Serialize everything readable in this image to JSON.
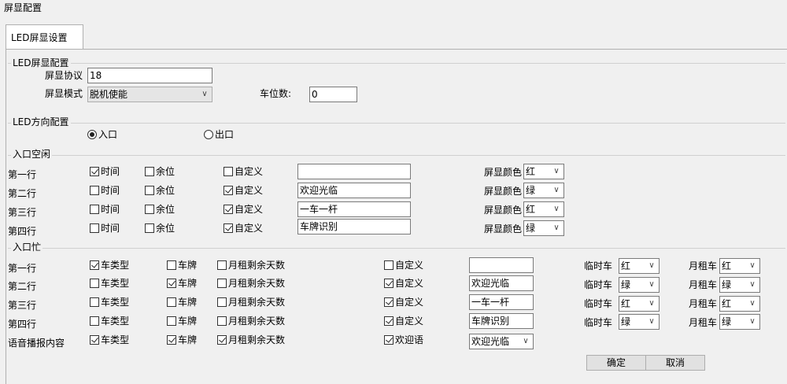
{
  "window": {
    "title": "屏显配置"
  },
  "tab": {
    "label": "LED屏显设置"
  },
  "led_config": {
    "legend": "LED屏显配置",
    "protocol_label": "屏显协议",
    "protocol_value": "18",
    "mode_label": "屏显模式",
    "mode_value": "脱机使能",
    "spaces_label": "车位数:",
    "spaces_value": "0"
  },
  "direction": {
    "legend": "LED方向配置",
    "entry": "入口",
    "exit": "出口"
  },
  "idle": {
    "legend": "入口空闲",
    "color_label": "屏显颜色",
    "rows": [
      {
        "label": "第一行",
        "time": "时间",
        "time_checked": true,
        "remain": "余位",
        "remain_checked": false,
        "custom": "自定义",
        "custom_checked": false,
        "text": "",
        "color": "红"
      },
      {
        "label": "第二行",
        "time": "时间",
        "time_checked": false,
        "remain": "余位",
        "remain_checked": false,
        "custom": "自定义",
        "custom_checked": true,
        "text": "欢迎光临",
        "color": "绿"
      },
      {
        "label": "第三行",
        "time": "时间",
        "time_checked": false,
        "remain": "余位",
        "remain_checked": false,
        "custom": "自定义",
        "custom_checked": true,
        "text": "一车一杆",
        "color": "红"
      },
      {
        "label": "第四行",
        "time": "时间",
        "time_checked": false,
        "remain": "余位",
        "remain_checked": false,
        "custom": "自定义",
        "custom_checked": true,
        "text": "车牌识别",
        "color": "绿"
      }
    ]
  },
  "busy": {
    "legend": "入口忙",
    "temp_label": "临时车",
    "monthly_label": "月租车",
    "rows": [
      {
        "label": "第一行",
        "cartype": "车类型",
        "cartype_checked": true,
        "plate": "车牌",
        "plate_checked": false,
        "days": "月租剩余天数",
        "days_checked": false,
        "custom": "自定义",
        "custom_checked": false,
        "text": "",
        "temp_color": "红",
        "monthly_color": "红"
      },
      {
        "label": "第二行",
        "cartype": "车类型",
        "cartype_checked": false,
        "plate": "车牌",
        "plate_checked": true,
        "days": "月租剩余天数",
        "days_checked": false,
        "custom": "自定义",
        "custom_checked": true,
        "text": "欢迎光临",
        "temp_color": "绿",
        "monthly_color": "绿"
      },
      {
        "label": "第三行",
        "cartype": "车类型",
        "cartype_checked": false,
        "plate": "车牌",
        "plate_checked": false,
        "days": "月租剩余天数",
        "days_checked": false,
        "custom": "自定义",
        "custom_checked": true,
        "text": "一车一杆",
        "temp_color": "红",
        "monthly_color": "红"
      },
      {
        "label": "第四行",
        "cartype": "车类型",
        "cartype_checked": false,
        "plate": "车牌",
        "plate_checked": false,
        "days": "月租剩余天数",
        "days_checked": false,
        "custom": "自定义",
        "custom_checked": true,
        "text": "车牌识别",
        "temp_color": "绿",
        "monthly_color": "绿"
      }
    ],
    "voice": {
      "label": "语音播报内容",
      "cartype": "车类型",
      "cartype_checked": true,
      "plate": "车牌",
      "plate_checked": true,
      "days": "月租剩余天数",
      "days_checked": true,
      "welcome": "欢迎语",
      "welcome_checked": true,
      "welcome_value": "欢迎光临"
    }
  },
  "buttons": {
    "ok": "确定",
    "cancel": "取消"
  }
}
